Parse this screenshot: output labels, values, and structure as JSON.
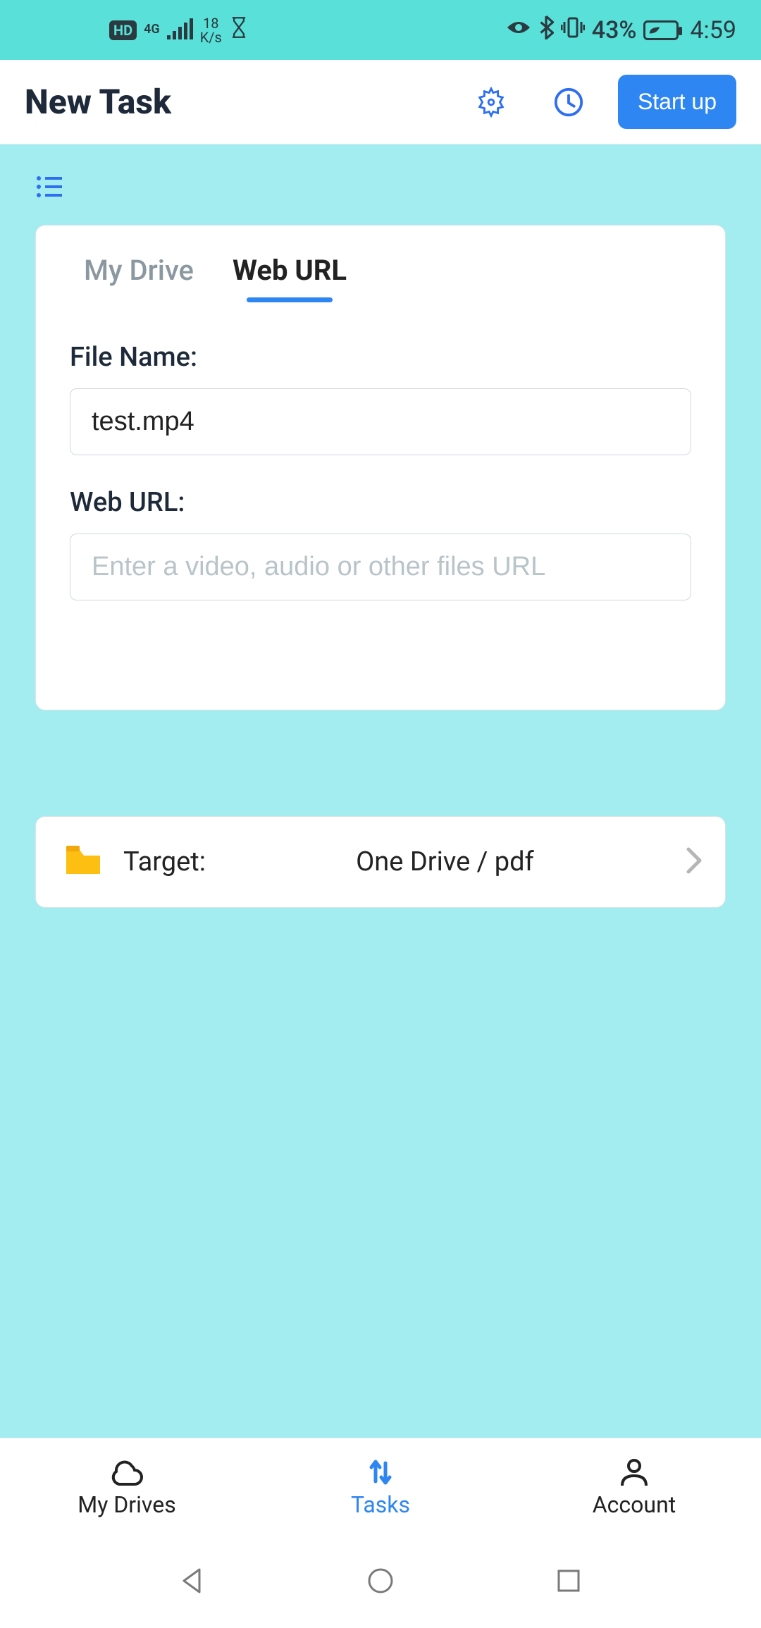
{
  "status": {
    "hd": "HD",
    "net_type": "4G",
    "speed_val": "18",
    "speed_unit": "K/s",
    "battery": "43%",
    "time": "4:59"
  },
  "header": {
    "title": "New Task",
    "startup": "Start up"
  },
  "tabs": {
    "my_drive": "My Drive",
    "web_url": "Web URL"
  },
  "form": {
    "file_name_label": "File Name:",
    "file_name_value": "test.mp4",
    "web_url_label": "Web URL:",
    "web_url_placeholder": "Enter a video, audio or other files URL"
  },
  "target": {
    "label": "Target:",
    "value": "One Drive / pdf"
  },
  "bottom_tabs": {
    "drives": "My Drives",
    "tasks": "Tasks",
    "account": "Account"
  }
}
